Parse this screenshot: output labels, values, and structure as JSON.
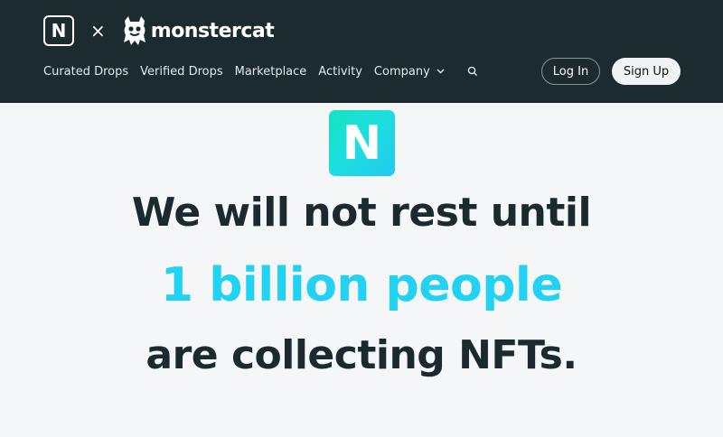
{
  "header": {
    "brand_letter": "N",
    "times_symbol": "×",
    "partner_name": "monstercat",
    "nav": [
      {
        "label": "Curated Drops"
      },
      {
        "label": "Verified Drops"
      },
      {
        "label": "Marketplace"
      },
      {
        "label": "Activity"
      },
      {
        "label": "Company"
      }
    ],
    "login_label": "Log In",
    "signup_label": "Sign Up"
  },
  "hero": {
    "logo_letter": "N",
    "line1": "We will not rest until",
    "line2": "1 billion people",
    "line3": "are collecting NFTs."
  },
  "colors": {
    "header_bg": "#1c2b2f",
    "accent": "#22d2f2",
    "text_dark": "#1b2a2e"
  },
  "icons": [
    "chevron-down-icon",
    "search-icon",
    "monstercat-icon"
  ]
}
